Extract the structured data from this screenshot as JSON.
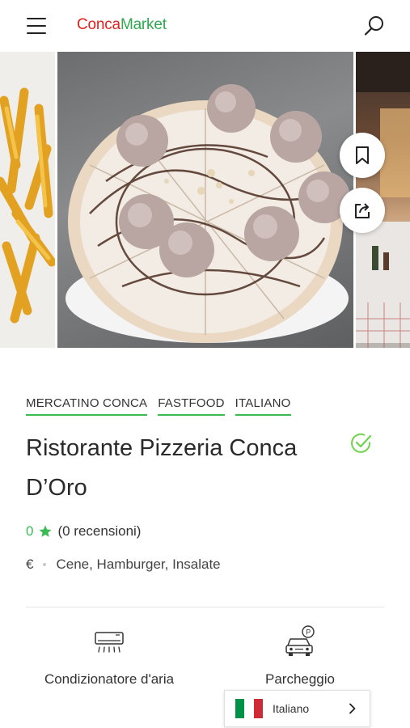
{
  "header": {
    "logo_part1": "Conca",
    "logo_part2": "Market"
  },
  "tags": [
    "MERCATINO CONCA",
    "FASTFOOD",
    "ITALIANO"
  ],
  "listing": {
    "title": "Ristorante Pizzeria Conca D’Oro",
    "rating_value": "0",
    "reviews_text": "(0 recensioni)",
    "price": "€",
    "categories": "Cene, Hamburger, Insalate"
  },
  "amenities": {
    "ac_label": "Condizionatore d'aria",
    "parking_label": "Parcheggio"
  },
  "language": {
    "label": "Italiano",
    "flag_colors": [
      "#009246",
      "#ffffff",
      "#ce2b37"
    ]
  },
  "colors": {
    "brand_red": "#e02020",
    "brand_green": "#2fa84f",
    "accent_green": "#3cba54"
  },
  "icons": {
    "menu": "hamburger-menu-icon",
    "search": "search-icon",
    "bookmark": "bookmark-icon",
    "share": "share-icon",
    "verified": "verified-check-icon",
    "star": "star-icon",
    "ac": "air-conditioner-icon",
    "parking": "parking-car-icon",
    "chevron": "chevron-right-icon"
  }
}
